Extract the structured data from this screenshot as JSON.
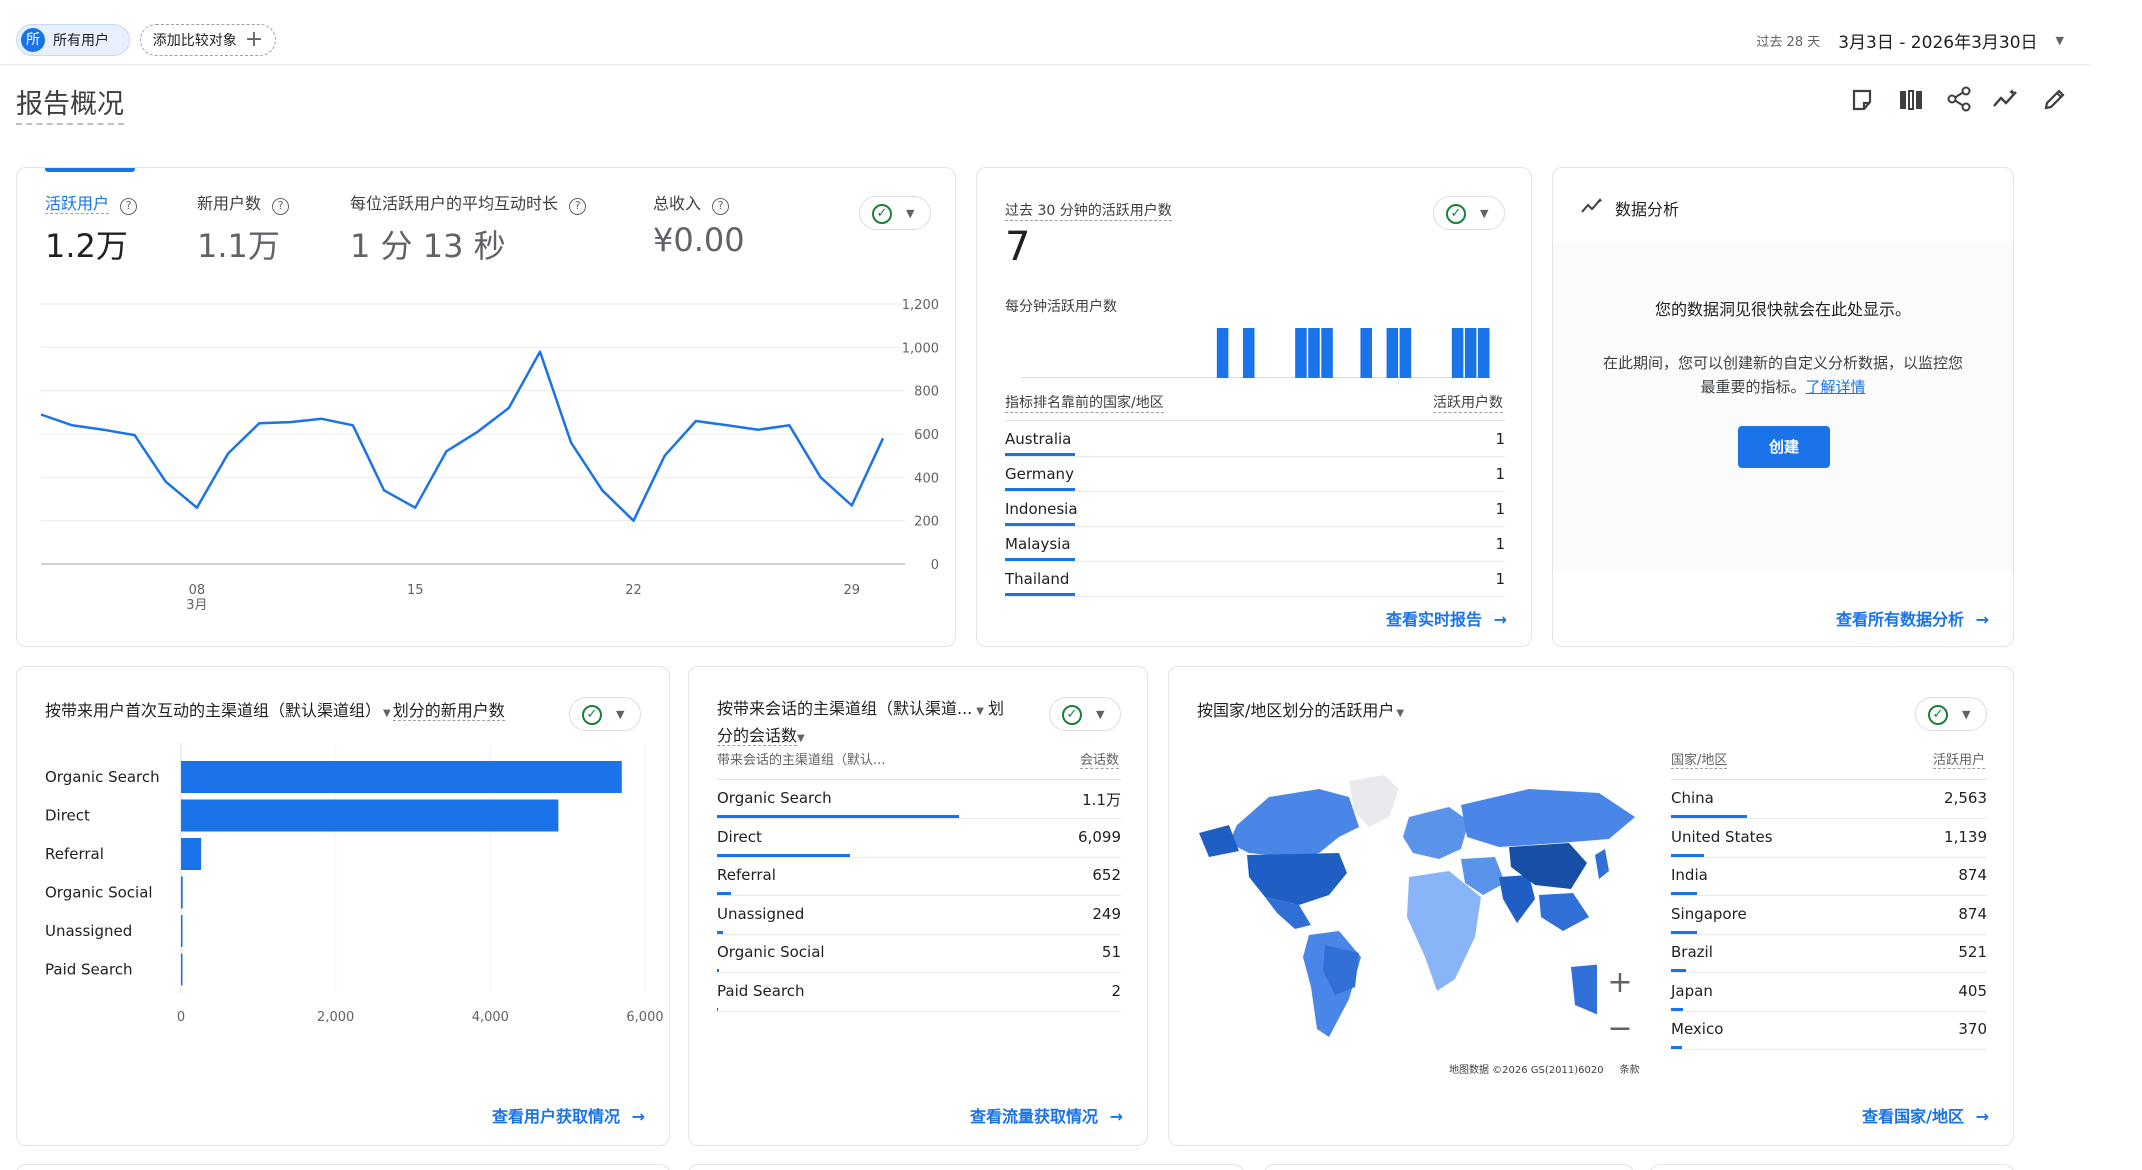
{
  "header": {
    "user_chip": {
      "avatar": "所",
      "label": "所有用户"
    },
    "compare_chip": "添加比较对象",
    "date_range": {
      "preset": "过去 28 天",
      "range": "3月3日 - 2026年3月30日"
    },
    "page_title": "报告概况",
    "toolbar_icons": [
      "edit-note-icon",
      "compare-columns-icon",
      "share-icon",
      "insights-icon",
      "pencil-icon"
    ]
  },
  "summary_card": {
    "metrics": [
      {
        "label": "活跃用户",
        "value": "1.2万",
        "active": true
      },
      {
        "label": "新用户数",
        "value": "1.1万",
        "active": false
      },
      {
        "label": "每位活跃用户的平均互动时长",
        "value": "1 分 13 秒",
        "active": false
      },
      {
        "label": "总收入",
        "value": "¥0.00",
        "active": false
      }
    ],
    "chart_data": {
      "type": "line",
      "x": [
        3,
        4,
        5,
        6,
        7,
        8,
        9,
        10,
        11,
        12,
        13,
        14,
        15,
        16,
        17,
        18,
        19,
        20,
        21,
        22,
        23,
        24,
        25,
        26,
        27,
        28,
        29,
        30
      ],
      "series": [
        {
          "values": [
            690,
            640,
            620,
            595,
            380,
            260,
            510,
            650,
            655,
            670,
            640,
            340,
            260,
            520,
            610,
            720,
            980,
            560,
            340,
            200,
            500,
            660,
            640,
            620,
            640,
            400,
            270,
            580
          ]
        }
      ],
      "xticks": [
        {
          "x": 8,
          "label": "08",
          "sub": "3月"
        },
        {
          "x": 15,
          "label": "15"
        },
        {
          "x": 22,
          "label": "22"
        },
        {
          "x": 29,
          "label": "29"
        }
      ],
      "yticks": [
        "1,200",
        "1,000",
        "800",
        "600",
        "400",
        "200",
        "0"
      ],
      "ylim": [
        0,
        1200
      ],
      "color": "#1a73e8",
      "grid": true
    }
  },
  "realtime_card": {
    "title": "过去 30 分钟的活跃用户数",
    "value": "7",
    "subtitle": "每分钟活跃用户数",
    "chart_data": {
      "type": "bar",
      "values": [
        0,
        0,
        0,
        0,
        0,
        0,
        0,
        0,
        0,
        0,
        0,
        0,
        0,
        0,
        0,
        1,
        0,
        1,
        0,
        0,
        0,
        1,
        1,
        1,
        0,
        0,
        1,
        0,
        1,
        1,
        0,
        0,
        0,
        1,
        1,
        1
      ],
      "ylim": [
        0,
        1
      ],
      "color": "#1a73e8"
    },
    "table_header": {
      "name": "指标排名靠前的国家/地区",
      "value": "活跃用户数"
    },
    "rows": [
      {
        "name": "Australia",
        "value": "1"
      },
      {
        "name": "Germany",
        "value": "1"
      },
      {
        "name": "Indonesia",
        "value": "1"
      },
      {
        "name": "Malaysia",
        "value": "1"
      },
      {
        "name": "Thailand",
        "value": "1"
      }
    ],
    "link": "查看实时报告"
  },
  "insights_card": {
    "title": "数据分析",
    "headline": "您的数据洞见很快就会在此处显示。",
    "body": "在此期间，您可以创建新的自定义分析数据，以监控您",
    "body2_prefix": "最重要的指标。",
    "learn_more": "了解详情",
    "create_button": "创建",
    "link": "查看所有数据分析"
  },
  "acquisition_card": {
    "title_prefix": "按带来用户首次互动的主渠道组（默认渠道组）",
    "title_suffix": "划分的新用户数",
    "chart_data": {
      "type": "bar",
      "orientation": "horizontal",
      "categories": [
        "Organic Search",
        "Direct",
        "Referral",
        "Organic Social",
        "Unassigned",
        "Paid Search"
      ],
      "values": [
        5700,
        4880,
        260,
        22,
        20,
        4
      ],
      "xticks": [
        "0",
        "2,000",
        "4,000",
        "6,000"
      ],
      "xlim": [
        0,
        6000
      ],
      "color": "#1a73e8"
    },
    "link": "查看用户获取情况"
  },
  "traffic_card": {
    "title_line1": "按带来会话的主渠道组（默认渠道...",
    "title_line1_suffix": "划",
    "title_line2": "分的会话数",
    "col_name": "带来会话的主渠道组（默认...",
    "col_value": "会话数",
    "rows": [
      {
        "name": "Organic Search",
        "value": "1.1万",
        "share": 0.6
      },
      {
        "name": "Direct",
        "value": "6,099",
        "share": 0.33
      },
      {
        "name": "Referral",
        "value": "652",
        "share": 0.035
      },
      {
        "name": "Unassigned",
        "value": "249",
        "share": 0.014
      },
      {
        "name": "Organic Social",
        "value": "51",
        "share": 0.005
      },
      {
        "name": "Paid Search",
        "value": "2",
        "share": 0.001
      }
    ],
    "link": "查看流量获取情况"
  },
  "geo_card": {
    "title": "按国家/地区划分的活跃用户",
    "col_name": "国家/地区",
    "col_value": "活跃用户",
    "rows": [
      {
        "name": "China",
        "value": "2,563",
        "share": 1.0
      },
      {
        "name": "United States",
        "value": "1,139",
        "share": 0.44
      },
      {
        "name": "India",
        "value": "874",
        "share": 0.34
      },
      {
        "name": "Singapore",
        "value": "874",
        "share": 0.34
      },
      {
        "name": "Brazil",
        "value": "521",
        "share": 0.2
      },
      {
        "name": "Japan",
        "value": "405",
        "share": 0.16
      },
      {
        "name": "Mexico",
        "value": "370",
        "share": 0.14
      }
    ],
    "map_attribution": "地图数据 ©2026 GS(2011)6020",
    "map_terms": "条款",
    "zoom_in": "+",
    "zoom_out": "−",
    "link": "查看国家/地区"
  }
}
